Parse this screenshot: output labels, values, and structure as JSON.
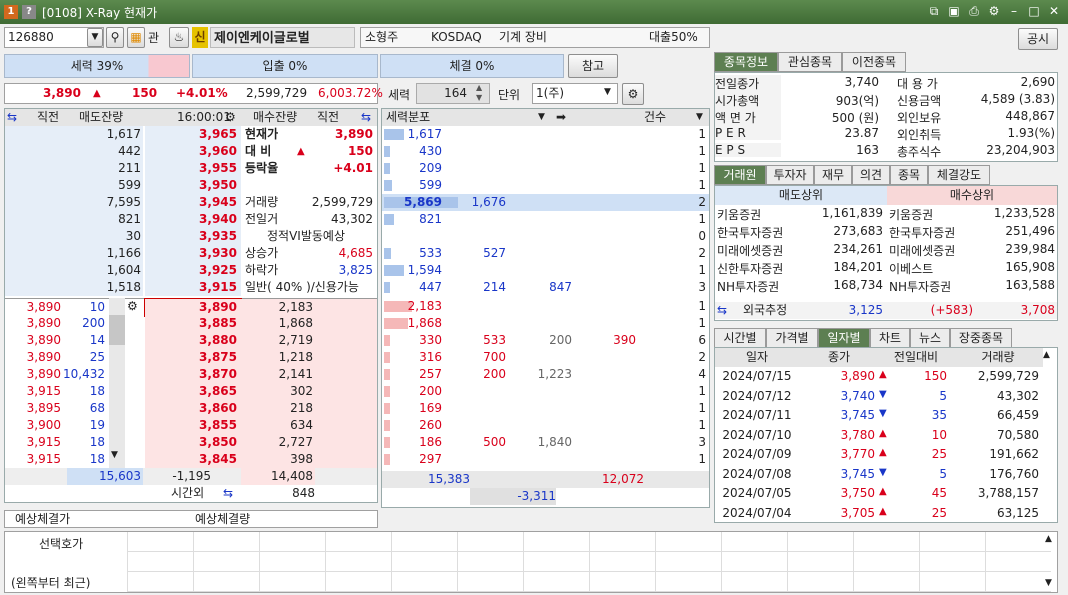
{
  "window": {
    "title": "[0108] X-Ray 현재가",
    "icon1": "1",
    "icon2": "?"
  },
  "toolbar": {
    "code": "126880",
    "btn_kwan": "관",
    "btn_sin": "신",
    "stock_name": "제이엔케이글로벌",
    "type": "소형주",
    "market": "KOSDAQ",
    "industry": "기계 장비",
    "loan": "대출50%",
    "notice": "공시"
  },
  "strength": {
    "label1": "세력 39%",
    "label2": "입출 0%",
    "label3": "체결 0%",
    "ref_btn": "참고"
  },
  "summary": {
    "price": "3,890",
    "arrow": "▲",
    "change": "150",
    "pct": "+4.01%",
    "volume": "2,599,729",
    "amount": "6,003.72%"
  },
  "ctrl": {
    "seryeok_label": "세력",
    "seryeok_value": "164",
    "unit_label": "단위",
    "unit_value": "1(주)"
  },
  "orderbook": {
    "headers": {
      "jikjeon": "직전",
      "sell_rem": "매도잔량",
      "time": "16:00:01",
      "buy_rem": "매수잔량",
      "jikjeon2": "직전"
    },
    "asks": [
      {
        "qty": "1,617",
        "price": "3,965"
      },
      {
        "qty": "442",
        "price": "3,960"
      },
      {
        "qty": "211",
        "price": "3,955"
      },
      {
        "qty": "599",
        "price": "3,950"
      },
      {
        "qty": "7,595",
        "price": "3,945"
      },
      {
        "qty": "821",
        "price": "3,940"
      },
      {
        "qty": "30",
        "price": "3,935"
      },
      {
        "qty": "1,166",
        "price": "3,930"
      },
      {
        "qty": "1,604",
        "price": "3,925"
      },
      {
        "qty": "1,518",
        "price": "3,915"
      }
    ],
    "info": [
      {
        "k": "현재가",
        "v": "3,890"
      },
      {
        "k": "대 비",
        "v": "150",
        "arrow": "▲"
      },
      {
        "k": "등락율",
        "v": "+4.01"
      },
      {
        "k": "",
        "v": ""
      },
      {
        "k": "거래량",
        "v": "2,599,729"
      },
      {
        "k": "전일거",
        "v": "43,302"
      },
      {
        "k": "정적VI발동예상",
        "v": ""
      },
      {
        "k": "상승가",
        "v": "4,685"
      },
      {
        "k": "하락가",
        "v": "3,825"
      },
      {
        "k": "일반( 40% )/신용가능",
        "v": ""
      }
    ],
    "bids": [
      {
        "prev": "3,890",
        "pq": "10",
        "price": "3,890",
        "qty": "2,183"
      },
      {
        "prev": "3,890",
        "pq": "200",
        "price": "3,885",
        "qty": "1,868"
      },
      {
        "prev": "3,890",
        "pq": "14",
        "price": "3,880",
        "qty": "2,719"
      },
      {
        "prev": "3,890",
        "pq": "25",
        "price": "3,875",
        "qty": "1,218"
      },
      {
        "prev": "3,890",
        "pq": "10,432",
        "price": "3,870",
        "qty": "2,141"
      },
      {
        "prev": "3,915",
        "pq": "18",
        "price": "3,865",
        "qty": "302"
      },
      {
        "prev": "3,895",
        "pq": "68",
        "price": "3,860",
        "qty": "218"
      },
      {
        "prev": "3,900",
        "pq": "19",
        "price": "3,855",
        "qty": "634"
      },
      {
        "prev": "3,915",
        "pq": "18",
        "price": "3,850",
        "qty": "2,727"
      },
      {
        "prev": "3,915",
        "pq": "18",
        "price": "3,845",
        "qty": "398"
      }
    ],
    "totals": {
      "sell": "15,603",
      "diff": "-1,195",
      "buy": "14,408",
      "overtime_label": "시간외",
      "overtime": "848"
    }
  },
  "dist": {
    "header": "세력분포",
    "count_header": "건수",
    "ask_rows": [
      {
        "a": "1,617",
        "b": "",
        "c": "",
        "d": "",
        "n": "1"
      },
      {
        "a": "430",
        "b": "",
        "c": "",
        "d": "",
        "n": "1"
      },
      {
        "a": "209",
        "b": "",
        "c": "",
        "d": "",
        "n": "1"
      },
      {
        "a": "599",
        "b": "",
        "c": "",
        "d": "",
        "n": "1"
      },
      {
        "a": "5,869",
        "b": "1,676",
        "c": "",
        "d": "",
        "n": "2"
      },
      {
        "a": "821",
        "b": "",
        "c": "",
        "d": "",
        "n": "1"
      },
      {
        "a": "",
        "b": "",
        "c": "",
        "d": "",
        "n": "0"
      },
      {
        "a": "533",
        "b": "527",
        "c": "",
        "d": "",
        "n": "2"
      },
      {
        "a": "1,594",
        "b": "",
        "c": "",
        "d": "",
        "n": "1"
      },
      {
        "a": "447",
        "b": "214",
        "c": "847",
        "d": "",
        "n": "3"
      }
    ],
    "bid_rows": [
      {
        "a": "2,183",
        "b": "",
        "c": "",
        "d": "",
        "n": "1"
      },
      {
        "a": "1,868",
        "b": "",
        "c": "",
        "d": "",
        "n": "1"
      },
      {
        "a": "330",
        "b": "533",
        "c": "200",
        "d": "390",
        "n": "6"
      },
      {
        "a": "316",
        "b": "700",
        "c": "",
        "d": "",
        "n": "2"
      },
      {
        "a": "257",
        "b": "200",
        "c": "1,223",
        "d": "",
        "n": "4"
      },
      {
        "a": "200",
        "b": "",
        "c": "",
        "d": "",
        "n": "1"
      },
      {
        "a": "169",
        "b": "",
        "c": "",
        "d": "",
        "n": "1"
      },
      {
        "a": "260",
        "b": "",
        "c": "",
        "d": "",
        "n": "1"
      },
      {
        "a": "186",
        "b": "500",
        "c": "1,840",
        "d": "",
        "n": "3"
      },
      {
        "a": "297",
        "b": "",
        "c": "",
        "d": "",
        "n": "1"
      }
    ],
    "total_left": "15,383",
    "total_right": "12,072",
    "net": "-3,311"
  },
  "bottom": {
    "expect_price": "예상체결가",
    "expect_qty": "예상체결량",
    "select_label": "선택호가",
    "recent_label": "(왼쪽부터 최근)"
  },
  "right": {
    "tabs": [
      "종목정보",
      "관심종목",
      "이전종목"
    ],
    "info": [
      {
        "k": "전일종가",
        "v": "3,740",
        "k2": "대 용 가",
        "v2": "2,690"
      },
      {
        "k": "시가총액",
        "v": "903(억)",
        "k2": "신용금액",
        "v2": "4,589  (3.83)"
      },
      {
        "k": "액 면 가",
        "v": "500 (원)",
        "k2": "외인보유",
        "v2": "448,867"
      },
      {
        "k": "P E R",
        "v": "23.87",
        "k2": "외인취득",
        "v2": "1.93(%)"
      },
      {
        "k": "E P S",
        "v": "163",
        "k2": "총주식수",
        "v2": "23,204,903"
      }
    ],
    "tabs2": [
      "거래원",
      "투자자",
      "재무",
      "의견",
      "종목",
      "체결강도"
    ],
    "broker_headers": {
      "sell": "매도상위",
      "buy": "매수상위"
    },
    "brokers": [
      {
        "s": "키움증권",
        "sv": "1,161,839",
        "b": "키움증권",
        "bv": "1,233,528"
      },
      {
        "s": "한국투자증권",
        "sv": "273,683",
        "b": "한국투자증권",
        "bv": "251,496"
      },
      {
        "s": "미래에셋증권",
        "sv": "234,261",
        "b": "미래에셋증권",
        "bv": "239,984"
      },
      {
        "s": "신한투자증권",
        "sv": "184,201",
        "b": "이베스트",
        "bv": "165,908"
      },
      {
        "s": "NH투자증권",
        "sv": "168,734",
        "b": "NH투자증권",
        "bv": "163,588"
      }
    ],
    "foreign": {
      "label": "외국추정",
      "v1": "3,125",
      "v2": "(+583)",
      "v3": "3,708"
    },
    "tabs3": [
      "시간별",
      "가격별",
      "일자별",
      "차트",
      "뉴스",
      "장중종목"
    ],
    "daily_headers": [
      "일자",
      "종가",
      "전일대비",
      "거래량"
    ],
    "daily": [
      {
        "d": "2024/07/15",
        "p": "3,890",
        "dir": "up",
        "c": "150",
        "v": "2,599,729"
      },
      {
        "d": "2024/07/12",
        "p": "3,740",
        "dir": "down",
        "c": "5",
        "v": "43,302"
      },
      {
        "d": "2024/07/11",
        "p": "3,745",
        "dir": "down",
        "c": "35",
        "v": "66,459"
      },
      {
        "d": "2024/07/10",
        "p": "3,780",
        "dir": "up",
        "c": "10",
        "v": "70,580"
      },
      {
        "d": "2024/07/09",
        "p": "3,770",
        "dir": "up",
        "c": "25",
        "v": "191,662"
      },
      {
        "d": "2024/07/08",
        "p": "3,745",
        "dir": "down",
        "c": "5",
        "v": "176,760"
      },
      {
        "d": "2024/07/05",
        "p": "3,750",
        "dir": "up",
        "c": "45",
        "v": "3,788,157"
      },
      {
        "d": "2024/07/04",
        "p": "3,705",
        "dir": "up",
        "c": "25",
        "v": "63,125"
      }
    ]
  }
}
